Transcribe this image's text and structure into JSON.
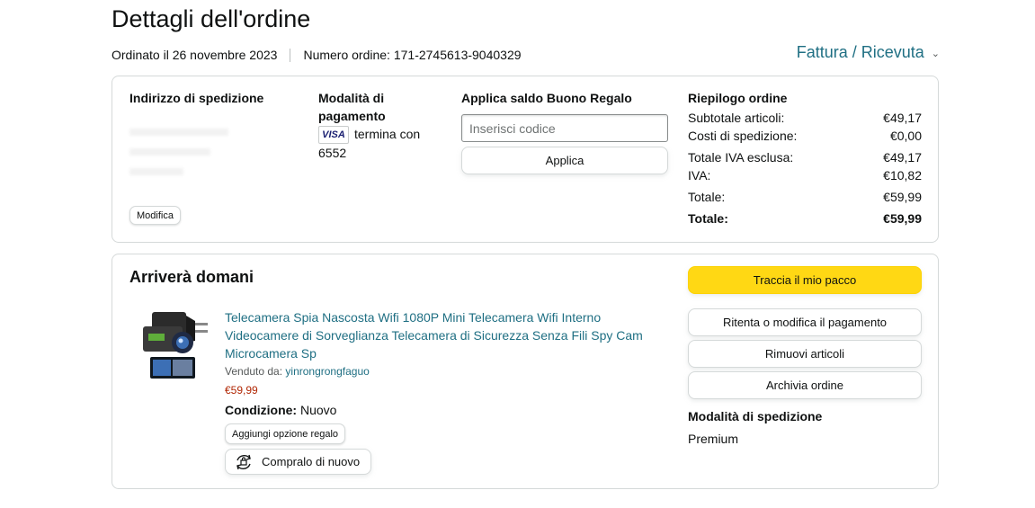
{
  "header": {
    "title": "Dettagli dell'ordine",
    "ordered_on": "Ordinato il 26 novembre 2023",
    "order_number": "Numero ordine: 171-2745613-9040329",
    "invoice_link": "Fattura / Ricevuta"
  },
  "shipping": {
    "heading": "Indirizzo di spedizione",
    "edit_button": "Modifica"
  },
  "payment": {
    "heading": "Modalità di pagamento",
    "card_brand": "VISA",
    "card_text": "termina con 6552"
  },
  "gift_card": {
    "heading": "Applica saldo Buono Regalo",
    "input_placeholder": "Inserisci codice",
    "apply_button": "Applica"
  },
  "summary": {
    "heading": "Riepilogo ordine",
    "rows": [
      {
        "label": "Subtotale articoli:",
        "value": "€49,17"
      },
      {
        "label": "Costi di spedizione:",
        "value": "€0,00"
      },
      {
        "label": "Totale IVA esclusa:",
        "value": "€49,17"
      },
      {
        "label": "IVA:",
        "value": "€10,82"
      },
      {
        "label": "Totale:",
        "value": "€59,99"
      },
      {
        "label": "Totale:",
        "value": "€59,99"
      }
    ]
  },
  "shipment": {
    "title": "Arriverà domani",
    "product": {
      "title": "Telecamera Spia Nascosta Wifi 1080P Mini Telecamera Wifi Interno Videocamere di Sorveglianza Telecamera di Sicurezza Senza Fili Spy Cam Microcamera Sp",
      "sold_by_label": "Venduto da: ",
      "seller": "yinrongrongfaguo",
      "price": "€59,99",
      "condition_label": "Condizione:",
      "condition_value": "Nuovo",
      "gift_button": "Aggiungi opzione regalo",
      "rebuy_button": "Compralo di nuovo"
    },
    "actions": {
      "track": "Traccia il mio pacco",
      "retry_payment": "Ritenta o modifica il pagamento",
      "remove_items": "Rimuovi articoli",
      "archive": "Archivia ordine"
    },
    "shipping_mode_heading": "Modalità di spedizione",
    "shipping_mode_value": "Premium"
  },
  "colors": {
    "link": "#1f6f83",
    "price": "#b12704",
    "primary_button": "#ffd814",
    "border": "#d5d9d9"
  }
}
